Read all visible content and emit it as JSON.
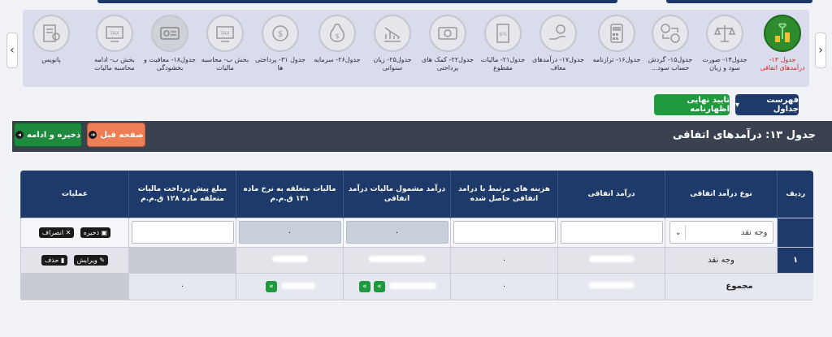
{
  "tiles": [
    {
      "label": "جدول ۱۳- درآمدهای اتفاقی",
      "icon": "coins-plant-icon",
      "active": true
    },
    {
      "label": "جدول۱۴- صورت سود و زیان",
      "icon": "scales-icon"
    },
    {
      "label": "جدول۱۵- گردش حساب سود...",
      "icon": "transfer-icon"
    },
    {
      "label": "جدول۱۶- ترازنامه",
      "icon": "calculator-icon"
    },
    {
      "label": "جدول۱۷- درآمدهای معاف",
      "icon": "hand-coin-icon"
    },
    {
      "label": "جدول۲۱- مالیات مقطوع",
      "icon": "tax-doc-icon"
    },
    {
      "label": "جدول۲۲- کمک های پرداختی",
      "icon": "money-icon"
    },
    {
      "label": "جدول۲۵- زیان سنواتی",
      "icon": "loss-chart-icon"
    },
    {
      "label": "جدول۲۶- سرمایه",
      "icon": "money-bag-icon"
    },
    {
      "label": "جدول ۳۱- پرداختی ها",
      "icon": "payment-icon"
    },
    {
      "label": "بخش ب- محاسبه مالیات",
      "icon": "tax-icon"
    },
    {
      "label": "جدول۱۸- معافیت و بخشودگی",
      "icon": "exemption-icon"
    },
    {
      "label": "بخش ب- ادامه محاسبه مالیات",
      "icon": "tax-icon-2"
    },
    {
      "label": "پانویس",
      "icon": "footnote-icon"
    }
  ],
  "buttons": {
    "list": "فهرست جداول",
    "confirm": "تایید نهایی اظهارنامه",
    "prev": "صفحه قبل",
    "save_continue": "ذخیره و ادامه"
  },
  "page_title": "جدول ۱۳: درآمدهای اتفاقی",
  "table": {
    "headers": [
      "ردیف",
      "نوع درآمد اتفاقی",
      "درآمد اتفاقی",
      "هزینه های مرتبط با درامد اتفاقی حاصل شده",
      "درآمد مشمول مالیات درآمد اتفاقی",
      "مالیات متعلقه به نرخ ماده ۱۳۱ ق.م.م",
      "مبلغ پیش پرداخت مالیات متعلقه ماده ۱۲۸ ق.م.م",
      "عملیات"
    ],
    "input_row": {
      "select_value": "وجه نقد",
      "taxable_value": "۰",
      "tax_value": "۰",
      "save": "ذخیره",
      "cancel": "انصراف"
    },
    "data_row": {
      "radif": "۱",
      "type": "وجه نقد",
      "costs": "۰",
      "edit": "ویرایش",
      "delete": "حذف"
    },
    "sum_row": {
      "label": "مجموع",
      "costs": "۰",
      "prepay": "۰"
    }
  },
  "colors": {
    "primary": "#1d3a6b",
    "success": "#1f9a3e",
    "orange": "#ee7e55",
    "header": "#3a4150"
  }
}
